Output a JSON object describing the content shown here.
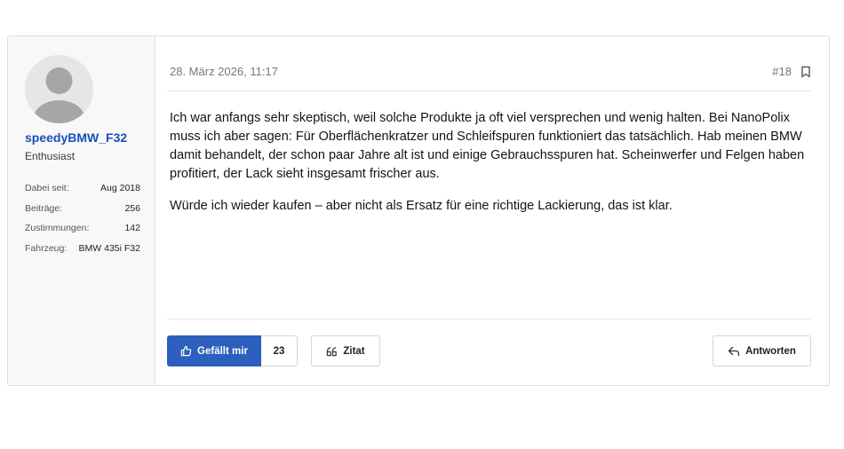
{
  "user": {
    "name": "speedyBMW_F32",
    "title": "Enthusiast",
    "stats": [
      {
        "label": "Dabei seit:",
        "value": "Aug 2018"
      },
      {
        "label": "Beiträge:",
        "value": "256"
      },
      {
        "label": "Zustimmungen:",
        "value": "142"
      },
      {
        "label": "Fahrzeug:",
        "value": "BMW 435i F32"
      }
    ]
  },
  "post": {
    "date": "28. März 2026, 11:17",
    "number": "#18",
    "paragraphs": [
      "Ich war anfangs sehr skeptisch, weil solche Produkte ja oft viel versprechen und wenig halten. Bei NanoPolix muss ich aber sagen: Für Oberflächenkratzer und Schleifspuren funktioniert das tatsächlich. Hab meinen BMW damit behandelt, der schon paar Jahre alt ist und einige Gebrauchsspuren hat. Scheinwerfer und Felgen haben profitiert, der Lack sieht insgesamt frischer aus.",
      "Würde ich wieder kaufen – aber nicht als Ersatz für eine richtige Lackierung, das ist klar."
    ]
  },
  "actions": {
    "like_label": "Gefällt mir",
    "like_count": "23",
    "quote_label": "Zitat",
    "reply_label": "Antworten"
  },
  "icons": {
    "avatar": "default-avatar-icon",
    "bookmark": "bookmark-icon",
    "like": "thumbs-up-icon",
    "quote": "quote-icon",
    "reply": "reply-icon"
  },
  "colors": {
    "accent": "#2d5fbd",
    "username": "#1a4fb8",
    "sidebar_bg": "#f8f8f8"
  }
}
